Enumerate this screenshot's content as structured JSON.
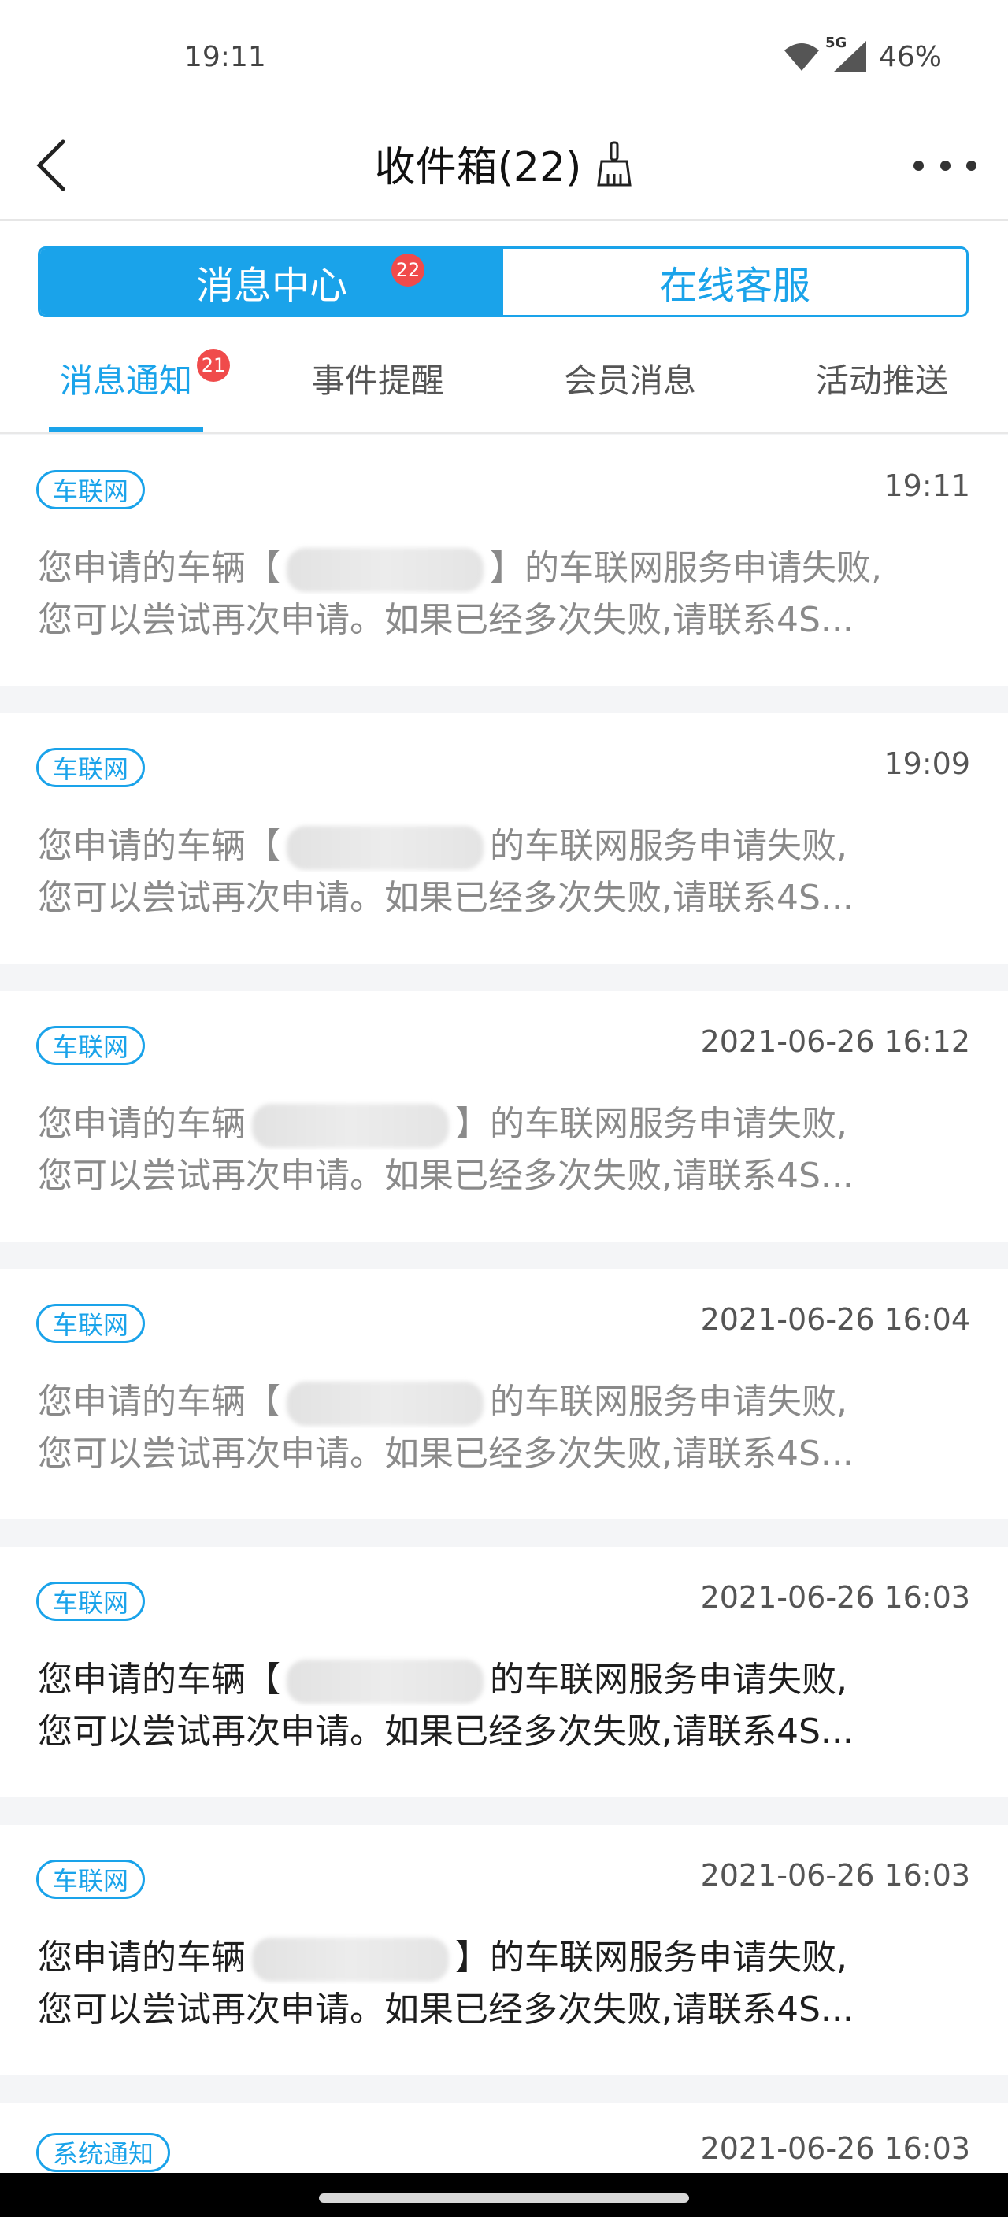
{
  "status_bar": {
    "time": "19:11",
    "network": "5G",
    "battery": "46%",
    "icons": [
      "wifi-icon",
      "signal-icon"
    ]
  },
  "header": {
    "title": "收件箱(22)",
    "icons": [
      "back-icon",
      "broom-icon",
      "more-icon"
    ]
  },
  "segment": {
    "active_label": "消息中心",
    "active_badge": "22",
    "inactive_label": "在线客服"
  },
  "tabs": [
    {
      "label": "消息通知",
      "badge": "21",
      "active": true
    },
    {
      "label": "事件提醒"
    },
    {
      "label": "会员消息"
    },
    {
      "label": "活动推送"
    }
  ],
  "colors": {
    "accent": "#1aa3ea",
    "badge": "#f04b4b"
  },
  "messages": [
    {
      "tag": "车联网",
      "time": "19:11",
      "line1a": "您申请的车辆【",
      "line1b": "】的车联网服务申请失败,",
      "line2": "您可以尝试再次申请。如果已经多次失败,请联系4S...",
      "read": true
    },
    {
      "tag": "车联网",
      "time": "19:09",
      "line1a": "您申请的车辆【",
      "line1b": "的车联网服务申请失败,",
      "line2": "您可以尝试再次申请。如果已经多次失败,请联系4S...",
      "read": true
    },
    {
      "tag": "车联网",
      "time": "2021-06-26 16:12",
      "line1a": "您申请的车辆",
      "line1b": "】的车联网服务申请失败,",
      "line2": "您可以尝试再次申请。如果已经多次失败,请联系4S...",
      "read": true
    },
    {
      "tag": "车联网",
      "time": "2021-06-26 16:04",
      "line1a": "您申请的车辆【",
      "line1b": "的车联网服务申请失败,",
      "line2": "您可以尝试再次申请。如果已经多次失败,请联系4S...",
      "read": true
    },
    {
      "tag": "车联网",
      "time": "2021-06-26 16:03",
      "line1a": "您申请的车辆【",
      "line1b": "的车联网服务申请失败,",
      "line2": "您可以尝试再次申请。如果已经多次失败,请联系4S...",
      "read": false
    },
    {
      "tag": "车联网",
      "time": "2021-06-26 16:03",
      "line1a": "您申请的车辆",
      "line1b": "】的车联网服务申请失败,",
      "line2": "您可以尝试再次申请。如果已经多次失败,请联系4S...",
      "read": false
    },
    {
      "tag": "系统通知",
      "time": "2021-06-26 16:03",
      "line1a": "",
      "line1b": "",
      "line2": "",
      "read": false
    }
  ]
}
